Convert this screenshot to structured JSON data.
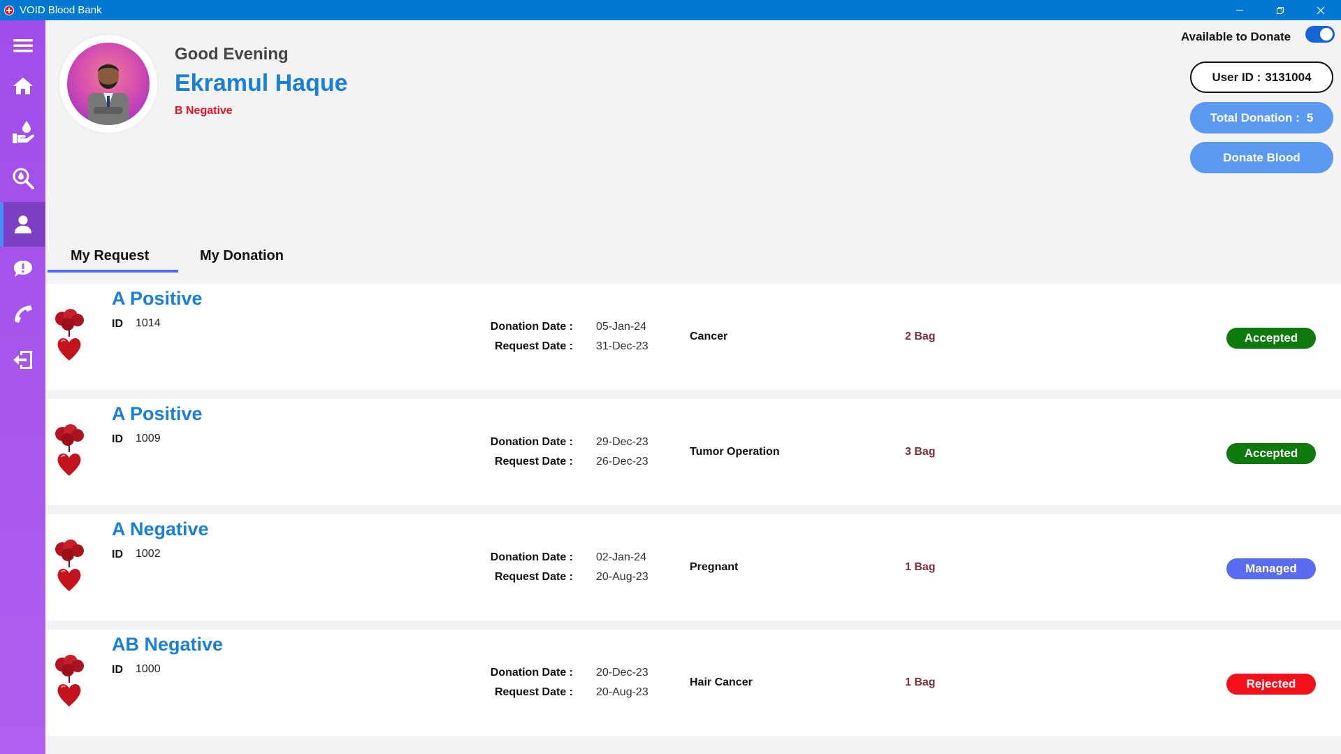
{
  "window": {
    "title": "VOID Blood Bank"
  },
  "profile": {
    "greeting": "Good Evening",
    "name": "Ekramul Haque",
    "blood_group": "B Negative"
  },
  "availability": {
    "label": "Available to Donate",
    "enabled": true
  },
  "user_id": {
    "label": "User ID :",
    "value": "3131004"
  },
  "total_donation": {
    "label": "Total Donation :",
    "value": "5"
  },
  "donate_button": "Donate Blood",
  "tabs": [
    {
      "label": "My Request",
      "active": true
    },
    {
      "label": "My Donation",
      "active": false
    }
  ],
  "labels": {
    "id": "ID",
    "donation_date": "Donation Date :",
    "request_date": "Request Date :"
  },
  "requests": [
    {
      "blood_group": "A Positive",
      "id": "1014",
      "donation_date": "05-Jan-24",
      "request_date": "31-Dec-23",
      "reason": "Cancer",
      "bags": "2 Bag",
      "status": "Accepted",
      "status_color": "#0e7a0d"
    },
    {
      "blood_group": "A Positive",
      "id": "1009",
      "donation_date": "29-Dec-23",
      "request_date": "26-Dec-23",
      "reason": "Tumor Operation",
      "bags": "3 Bag",
      "status": "Accepted",
      "status_color": "#0e7a0d"
    },
    {
      "blood_group": "A Negative",
      "id": "1002",
      "donation_date": "02-Jan-24",
      "request_date": "20-Aug-23",
      "reason": "Pregnant",
      "bags": "1 Bag",
      "status": "Managed",
      "status_color": "#5a6cf0"
    },
    {
      "blood_group": "AB Negative",
      "id": "1000",
      "donation_date": "20-Dec-23",
      "request_date": "20-Aug-23",
      "reason": "Hair Cancer",
      "bags": "1 Bag",
      "status": "Rejected",
      "status_color": "#f2111a"
    }
  ],
  "sidebar": {
    "items": [
      {
        "icon": "menu-icon"
      },
      {
        "icon": "home-icon"
      },
      {
        "icon": "donate-hand-icon"
      },
      {
        "icon": "search-blood-icon"
      },
      {
        "icon": "profile-icon",
        "active": true
      },
      {
        "icon": "chat-icon"
      },
      {
        "icon": "phone-icon"
      },
      {
        "icon": "logout-icon"
      }
    ]
  },
  "colors": {
    "accent_blue": "#1a7fd6",
    "sidebar": "#a04dea",
    "titlebar": "#0078d4"
  }
}
